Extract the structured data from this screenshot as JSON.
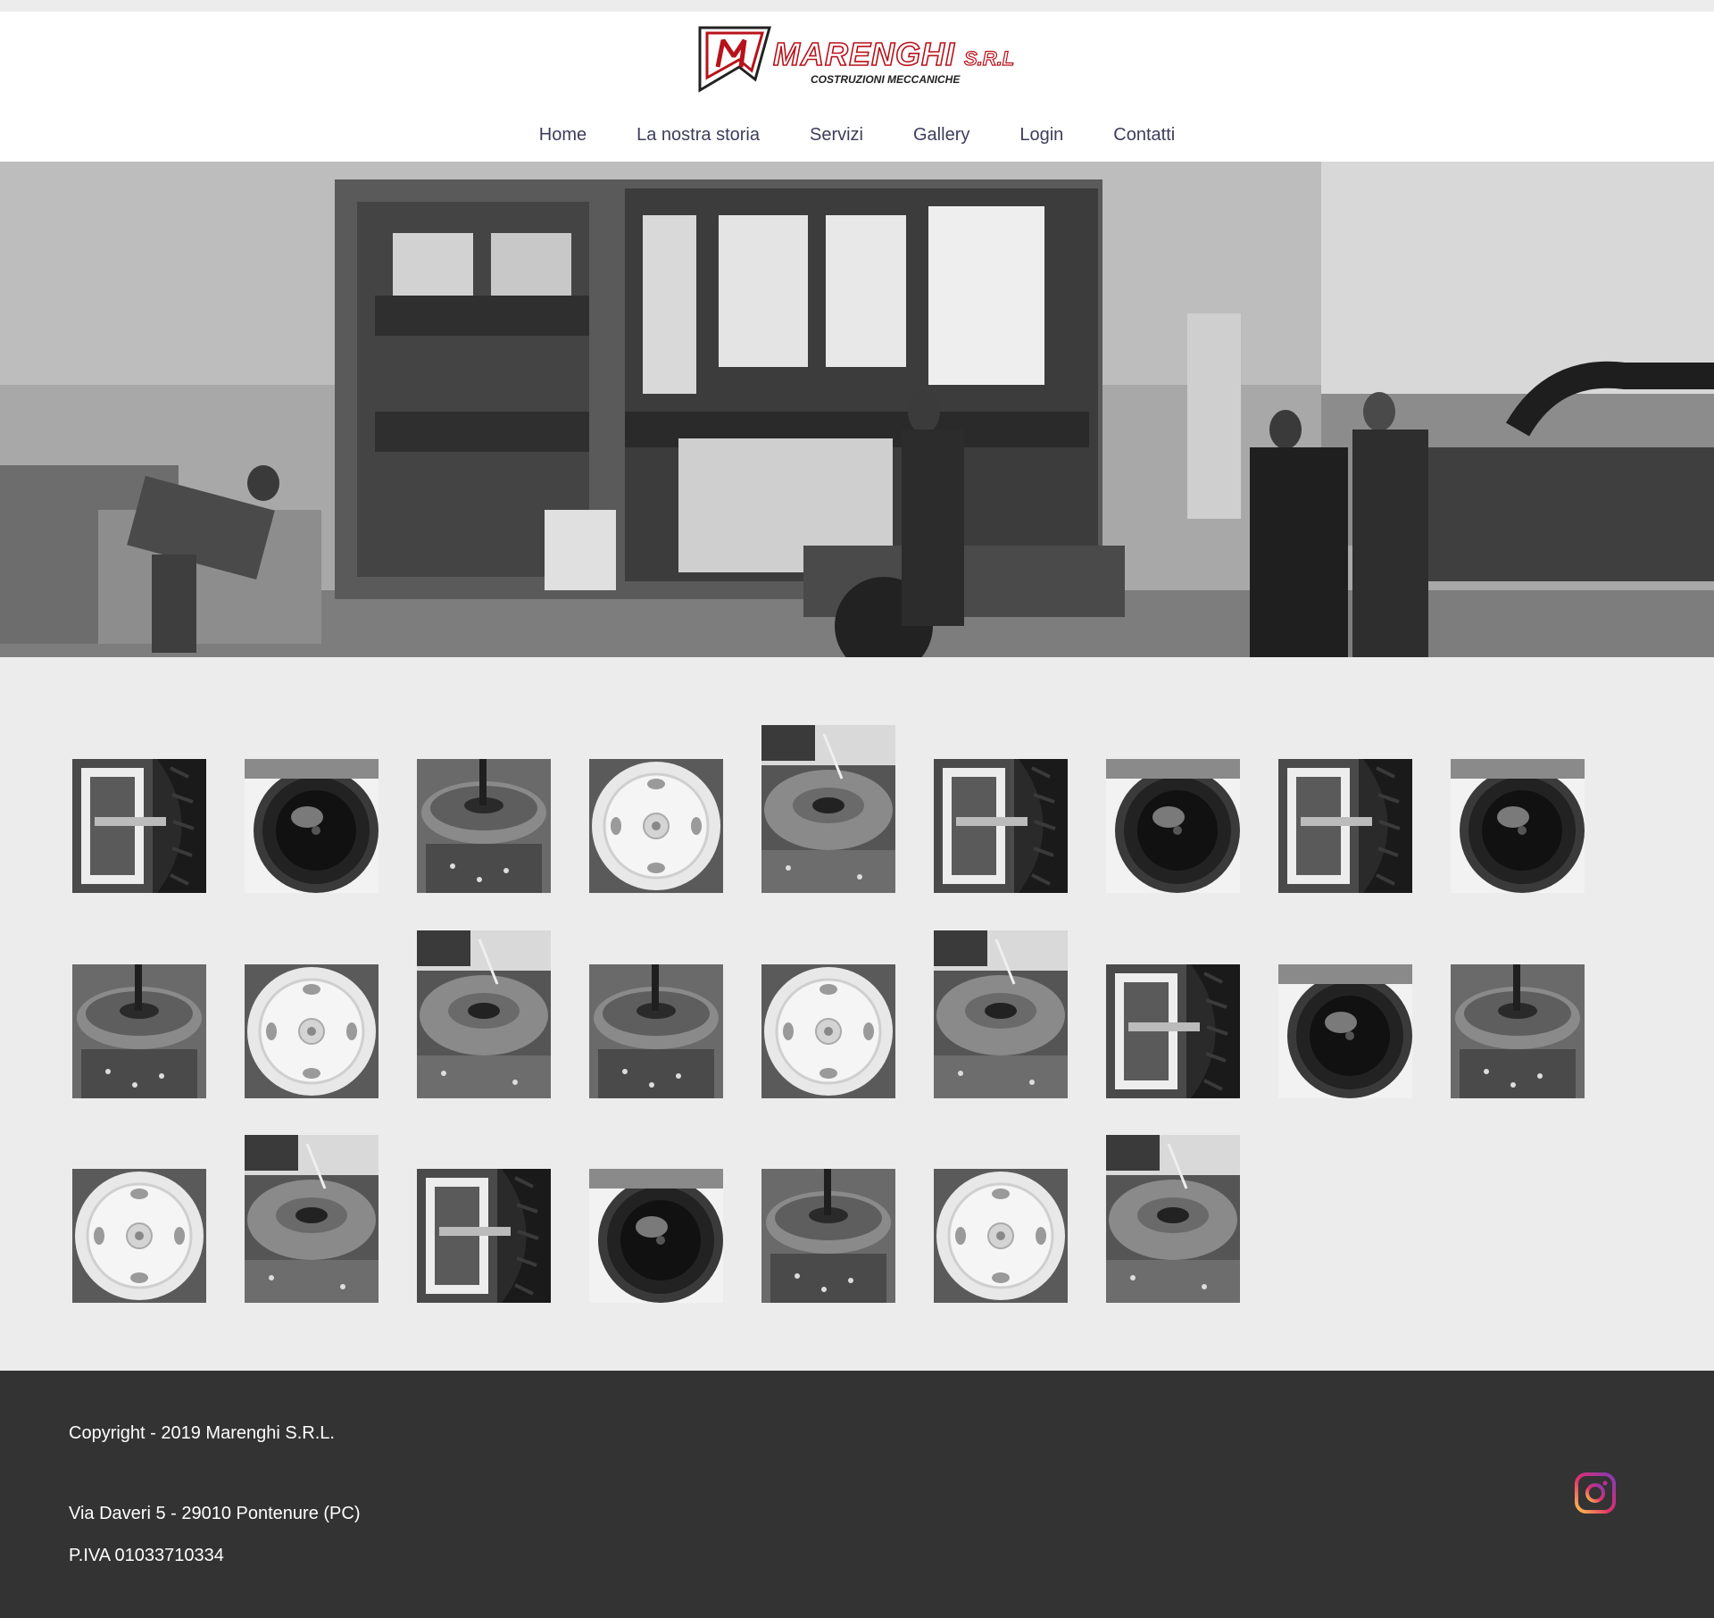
{
  "brand": {
    "logo_name": "MARENGHI",
    "logo_suffix": "S.R.L",
    "logo_tagline": "COSTRUZIONI  MECCANICHE",
    "colors": {
      "accent": "#b8121b",
      "nav_text": "#3d3d5c",
      "footer_bg": "#333333",
      "page_bg": "#ececec"
    }
  },
  "nav": {
    "items": [
      {
        "label": "Home"
      },
      {
        "label": "La nostra storia"
      },
      {
        "label": "Servizi"
      },
      {
        "label": "Gallery"
      },
      {
        "label": "Login"
      },
      {
        "label": "Contatti"
      }
    ]
  },
  "gallery": {
    "thumbnails": [
      {
        "subject": "tire-side"
      },
      {
        "subject": "tractor-wheel"
      },
      {
        "subject": "hub-part"
      },
      {
        "subject": "white-rim"
      },
      {
        "subject": "welding-part"
      },
      {
        "subject": "tire-side"
      },
      {
        "subject": "tractor-wheel"
      },
      {
        "subject": "tire-side"
      },
      {
        "subject": "tractor-wheel"
      },
      {
        "subject": "hub-part"
      },
      {
        "subject": "white-rim"
      },
      {
        "subject": "welding-part"
      },
      {
        "subject": "hub-part"
      },
      {
        "subject": "white-rim"
      },
      {
        "subject": "welding-part"
      },
      {
        "subject": "tire-side"
      },
      {
        "subject": "tractor-wheel"
      },
      {
        "subject": "hub-part"
      },
      {
        "subject": "white-rim"
      },
      {
        "subject": "welding-part"
      },
      {
        "subject": "tire-side"
      },
      {
        "subject": "tractor-wheel"
      },
      {
        "subject": "hub-part"
      },
      {
        "subject": "white-rim"
      },
      {
        "subject": "welding-part"
      }
    ]
  },
  "footer": {
    "copyright": "Copyright - 2019 Marenghi S.R.L.",
    "address": "Via Daveri 5 - 29010 Pontenure (PC)",
    "vat": "P.IVA 01033710334",
    "social_icon": "instagram-icon"
  }
}
